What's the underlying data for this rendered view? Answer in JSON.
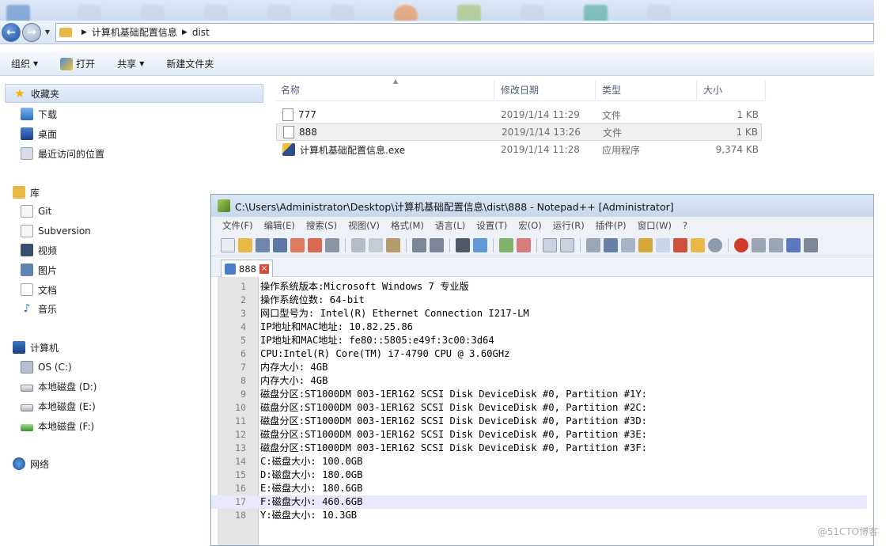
{
  "explorer": {
    "breadcrumb": [
      "计算机基础配置信息",
      "dist"
    ],
    "commands": [
      {
        "label": "组织",
        "has_dropdown": true
      },
      {
        "label": "打开",
        "icon": "shield-icon"
      },
      {
        "label": "共享",
        "has_dropdown": true
      },
      {
        "label": "新建文件夹",
        "has_dropdown": false
      }
    ],
    "sidebar": {
      "favorites": {
        "label": "收藏夹",
        "icon": "star-icon"
      },
      "fav_items": [
        {
          "label": "下载",
          "icon": "downloads-icon"
        },
        {
          "label": "桌面",
          "icon": "desktop-icon"
        },
        {
          "label": "最近访问的位置",
          "icon": "recent-places-icon"
        }
      ],
      "libraries": {
        "label": "库",
        "icon": "library-icon"
      },
      "lib_items": [
        {
          "label": "Git",
          "icon": "git-icon"
        },
        {
          "label": "Subversion",
          "icon": "subversion-icon"
        },
        {
          "label": "视频",
          "icon": "video-icon"
        },
        {
          "label": "图片",
          "icon": "pictures-icon"
        },
        {
          "label": "文档",
          "icon": "documents-icon"
        },
        {
          "label": "音乐",
          "icon": "music-icon"
        }
      ],
      "computer": {
        "label": "计算机",
        "icon": "computer-icon"
      },
      "drives": [
        {
          "label": "OS (C:)",
          "icon": "os-drive-icon"
        },
        {
          "label": "本地磁盘 (D:)",
          "icon": "drive-icon"
        },
        {
          "label": "本地磁盘 (E:)",
          "icon": "drive-icon"
        },
        {
          "label": "本地磁盘 (F:)",
          "icon": "drive-icon"
        }
      ],
      "network": {
        "label": "网络",
        "icon": "network-icon"
      }
    },
    "columns": {
      "name": "名称",
      "date": "修改日期",
      "type": "类型",
      "size": "大小"
    },
    "files": [
      {
        "name": "777",
        "date": "2019/1/14 11:29",
        "type": "文件",
        "size": "1 KB",
        "icon": "file-icon"
      },
      {
        "name": "888",
        "date": "2019/1/14 13:26",
        "type": "文件",
        "size": "1 KB",
        "icon": "file-icon",
        "selected": true
      },
      {
        "name": "计算机基础配置信息.exe",
        "date": "2019/1/14 11:28",
        "type": "应用程序",
        "size": "9,374 KB",
        "icon": "exe-icon"
      }
    ]
  },
  "notepad": {
    "title": "C:\\Users\\Administrator\\Desktop\\计算机基础配置信息\\dist\\888 - Notepad++ [Administrator]",
    "menu": [
      "文件(F)",
      "编辑(E)",
      "搜索(S)",
      "视图(V)",
      "格式(M)",
      "语言(L)",
      "设置(T)",
      "宏(O)",
      "运行(R)",
      "插件(P)",
      "窗口(W)",
      "?"
    ],
    "tab": {
      "label": "888"
    },
    "current_line": 17,
    "lines": [
      "操作系统版本:Microsoft Windows 7 专业版",
      "操作系统位数: 64-bit",
      "网口型号为: Intel(R) Ethernet Connection I217-LM",
      "IP地址和MAC地址: 10.82.25.86",
      "IP地址和MAC地址: fe80::5805:e49f:3c00:3d64",
      "CPU:Intel(R) Core(TM) i7-4790 CPU @ 3.60GHz",
      "内存大小: 4GB",
      "内存大小: 4GB",
      "磁盘分区:ST1000DM 003-1ER162 SCSI Disk DeviceDisk #0, Partition #1Y:",
      "磁盘分区:ST1000DM 003-1ER162 SCSI Disk DeviceDisk #0, Partition #2C:",
      "磁盘分区:ST1000DM 003-1ER162 SCSI Disk DeviceDisk #0, Partition #3D:",
      "磁盘分区:ST1000DM 003-1ER162 SCSI Disk DeviceDisk #0, Partition #3E:",
      "磁盘分区:ST1000DM 003-1ER162 SCSI Disk DeviceDisk #0, Partition #3F:",
      "C:磁盘大小: 100.0GB",
      "D:磁盘大小: 180.0GB",
      "E:磁盘大小: 180.6GB",
      "F:磁盘大小: 460.6GB",
      "Y:磁盘大小: 10.3GB"
    ]
  },
  "watermark": "@51CTO博客"
}
